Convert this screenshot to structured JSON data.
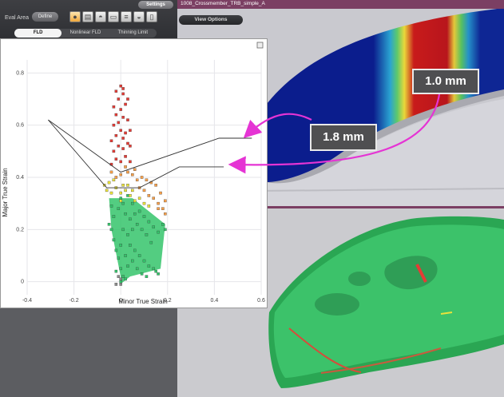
{
  "toolbar": {
    "settings_label": "Settings",
    "eval_area_label": "Eval Area",
    "define_label": "Define",
    "tools": [
      "fld-mode-icon",
      "chart-icon",
      "dome-icon",
      "sheet-icon",
      "stack-icon",
      "dome-alt-icon",
      "export-icon"
    ]
  },
  "tabs": [
    "FLD",
    "Nonlinear FLD",
    "Thinning Limit"
  ],
  "active_tab": "FLD",
  "viewport": {
    "file_title": "1008_Crossmember_TRB_simple_A",
    "view_options_label": "View Options"
  },
  "callouts": {
    "a": "1.0 mm",
    "b": "1.8 mm"
  },
  "colors": {
    "arrow": "#e534d4",
    "red": "#e53b35",
    "orange": "#f7a04a",
    "yellow": "#e9e23c",
    "green": "#35c46b",
    "fld_line": "#333333",
    "panel_dark": "#5c5d61",
    "title_bar": "#7b3f63"
  },
  "chart_data": {
    "type": "scatter",
    "title": "",
    "xlabel": "Minor True Strain",
    "ylabel": "Major True Strain",
    "xlim": [
      -0.4,
      0.6
    ],
    "ylim": [
      -0.05,
      0.85
    ],
    "xticks": [
      -0.4,
      -0.2,
      0,
      0.2,
      0.4,
      0.6
    ],
    "xtick_labels": [
      "-0.4",
      "-0.2",
      "0",
      "0.2",
      "0.4",
      "0.6"
    ],
    "yticks": [
      0,
      0.2,
      0.4,
      0.6,
      0.8
    ],
    "ytick_labels": [
      "0",
      "0.2",
      "0.4",
      "0.6",
      "0.8"
    ],
    "grid": true,
    "fld_curves": [
      {
        "name": "1.8 mm",
        "points": [
          [
            -0.31,
            0.62
          ],
          [
            0,
            0.42
          ],
          [
            0.42,
            0.55
          ],
          [
            0.56,
            0.55
          ]
        ]
      },
      {
        "name": "1.0 mm",
        "points": [
          [
            -0.31,
            0.62
          ],
          [
            -0.06,
            0.36
          ],
          [
            0.08,
            0.36
          ],
          [
            0.25,
            0.44
          ],
          [
            0.44,
            0.44
          ]
        ]
      }
    ],
    "point_clouds": [
      {
        "zone": "safe",
        "color": "#35c46b",
        "points": [
          [
            -0.05,
            0.22
          ],
          [
            -0.04,
            0.2
          ],
          [
            -0.03,
            0.16
          ],
          [
            -0.02,
            0.12
          ],
          [
            -0.01,
            0.09
          ],
          [
            0,
            0.05
          ],
          [
            0.01,
            0.02
          ],
          [
            0,
            0
          ],
          [
            0.02,
            0.1
          ],
          [
            0.04,
            0.14
          ],
          [
            0.06,
            0.12
          ],
          [
            0.08,
            0.1
          ],
          [
            0.1,
            0.08
          ],
          [
            0.12,
            0.06
          ],
          [
            0.14,
            0.05
          ],
          [
            0.15,
            0.04
          ],
          [
            0.16,
            0.03
          ],
          [
            0.03,
            0.18
          ],
          [
            0.05,
            0.2
          ],
          [
            0.07,
            0.22
          ],
          [
            0.09,
            0.2
          ],
          [
            0.11,
            0.18
          ],
          [
            0.13,
            0.15
          ],
          [
            -0.03,
            0.25
          ],
          [
            -0.01,
            0.28
          ],
          [
            0.01,
            0.3
          ],
          [
            0.02,
            0.26
          ],
          [
            0.04,
            0.24
          ],
          [
            0.06,
            0.26
          ],
          [
            0.08,
            0.27
          ],
          [
            0.1,
            0.25
          ],
          [
            0.12,
            0.23
          ],
          [
            0.14,
            0.21
          ],
          [
            0.16,
            0.19
          ],
          [
            0.18,
            0.22
          ],
          [
            0.19,
            0.2
          ],
          [
            -0.02,
            0.04
          ],
          [
            0.05,
            0.08
          ],
          [
            0.07,
            0.05
          ],
          [
            0.09,
            0.03
          ],
          [
            0.11,
            0.02
          ],
          [
            0.02,
            0.01
          ],
          [
            0.03,
            0.06
          ],
          [
            0,
            0.14
          ],
          [
            0.01,
            0.2
          ],
          [
            -0.04,
            0.29
          ],
          [
            0.0,
            0.32
          ],
          [
            0.03,
            0.33
          ],
          [
            0.05,
            0.3
          ]
        ]
      },
      {
        "zone": "marginal",
        "color": "#e9e23c",
        "points": [
          [
            -0.06,
            0.35
          ],
          [
            -0.04,
            0.34
          ],
          [
            -0.02,
            0.36
          ],
          [
            0,
            0.34
          ],
          [
            0.02,
            0.35
          ],
          [
            0.04,
            0.33
          ],
          [
            0.06,
            0.31
          ],
          [
            0.08,
            0.32
          ],
          [
            0.1,
            0.3
          ],
          [
            -0.05,
            0.38
          ],
          [
            -0.03,
            0.39
          ],
          [
            0.01,
            0.37
          ],
          [
            0.03,
            0.37
          ],
          [
            -0.07,
            0.37
          ],
          [
            0.05,
            0.35
          ],
          [
            0.0,
            0.31
          ],
          [
            0.12,
            0.29
          ]
        ]
      },
      {
        "zone": "risk",
        "color": "#f7a04a",
        "points": [
          [
            0.08,
            0.36
          ],
          [
            0.1,
            0.35
          ],
          [
            0.12,
            0.33
          ],
          [
            0.14,
            0.32
          ],
          [
            0.16,
            0.3
          ],
          [
            0.18,
            0.28
          ],
          [
            0.19,
            0.26
          ],
          [
            0.17,
            0.34
          ],
          [
            0.15,
            0.37
          ],
          [
            0.13,
            0.38
          ],
          [
            0.11,
            0.39
          ],
          [
            0.09,
            0.4
          ],
          [
            0.07,
            0.39
          ],
          [
            0.05,
            0.41
          ],
          [
            0.03,
            0.42
          ],
          [
            0.0,
            0.41
          ],
          [
            -0.02,
            0.4
          ],
          [
            -0.04,
            0.42
          ],
          [
            0.02,
            0.44
          ],
          [
            0.06,
            0.43
          ],
          [
            0.19,
            0.31
          ],
          [
            0.16,
            0.28
          ]
        ]
      },
      {
        "zone": "failure",
        "color": "#e53b35",
        "points": [
          [
            -0.04,
            0.45
          ],
          [
            -0.02,
            0.47
          ],
          [
            0,
            0.46
          ],
          [
            0.02,
            0.48
          ],
          [
            0.04,
            0.46
          ],
          [
            -0.03,
            0.5
          ],
          [
            -0.01,
            0.52
          ],
          [
            0.01,
            0.51
          ],
          [
            0.03,
            0.53
          ],
          [
            -0.02,
            0.56
          ],
          [
            0,
            0.58
          ],
          [
            0.02,
            0.57
          ],
          [
            0.01,
            0.55
          ],
          [
            -0.04,
            0.54
          ],
          [
            0.04,
            0.52
          ],
          [
            -0.01,
            0.61
          ],
          [
            0.01,
            0.63
          ],
          [
            0.03,
            0.62
          ],
          [
            -0.02,
            0.64
          ],
          [
            0,
            0.66
          ],
          [
            0.02,
            0.68
          ],
          [
            -0.01,
            0.7
          ],
          [
            0.01,
            0.72
          ],
          [
            0.0,
            0.75
          ],
          [
            -0.03,
            0.6
          ],
          [
            0.04,
            0.58
          ],
          [
            -0.03,
            0.67
          ],
          [
            0.03,
            0.7
          ],
          [
            -0.02,
            0.73
          ],
          [
            0.01,
            0.74
          ]
        ]
      },
      {
        "zone": "other",
        "color": "#8a8a8a",
        "points": [
          [
            -0.01,
            0.02
          ],
          [
            0.0,
            0.01
          ],
          [
            -0.02,
            -0.01
          ],
          [
            0.0,
            -0.01
          ]
        ]
      }
    ]
  }
}
